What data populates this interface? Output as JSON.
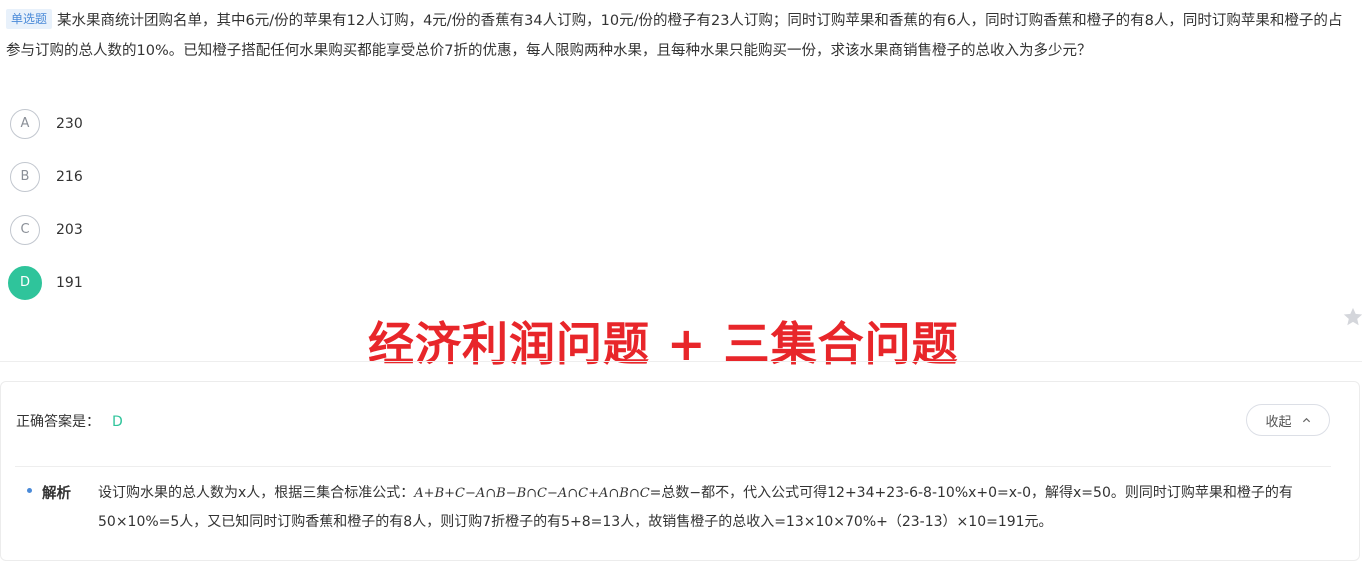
{
  "question": {
    "type_badge": "单选题",
    "text": "某水果商统计团购名单，其中6元/份的苹果有12人订购，4元/份的香蕉有34人订购，10元/份的橙子有23人订购；同时订购苹果和香蕉的有6人，同时订购香蕉和橙子的有8人，同时订购苹果和橙子的占参与订购的总人数的10%。已知橙子搭配任何水果购买都能享受总价7折的优惠，每人限购两种水果，且每种水果只能购买一份，求该水果商销售橙子的总收入为多少元？"
  },
  "options": [
    {
      "letter": "A",
      "text": "230"
    },
    {
      "letter": "B",
      "text": "216"
    },
    {
      "letter": "C",
      "text": "203"
    },
    {
      "letter": "D",
      "text": "191"
    }
  ],
  "selected_option": "D",
  "overlay_title": "经济利润问题 + 三集合问题",
  "answer": {
    "label": "正确答案是：",
    "value": "D",
    "collapse_label": "收起"
  },
  "analysis": {
    "label": "解析",
    "text_part1": "设订购水果的总人数为x人，根据三集合标准公式：",
    "formula": "A+B+C−A∩B−B∩C−A∩C+A∩B∩C",
    "text_part2": "=总数−都不，代入公式可得12+34+23-6-8-10%x+0=x-0，解得x=50。则同时订购苹果和橙子的有50×10%=5人，又已知同时订购香蕉和橙子的有8人，则订购7折橙子的有5+8=13人，故销售橙子的总收入=13×10×70%+（23-13）×10=191元。"
  },
  "icons": {
    "star": "star-icon",
    "chevron": "chevron-up-icon"
  },
  "colors": {
    "accent_green": "#2fc49b",
    "overlay_red": "#e8262a",
    "badge_blue": "#4a8ad8"
  }
}
